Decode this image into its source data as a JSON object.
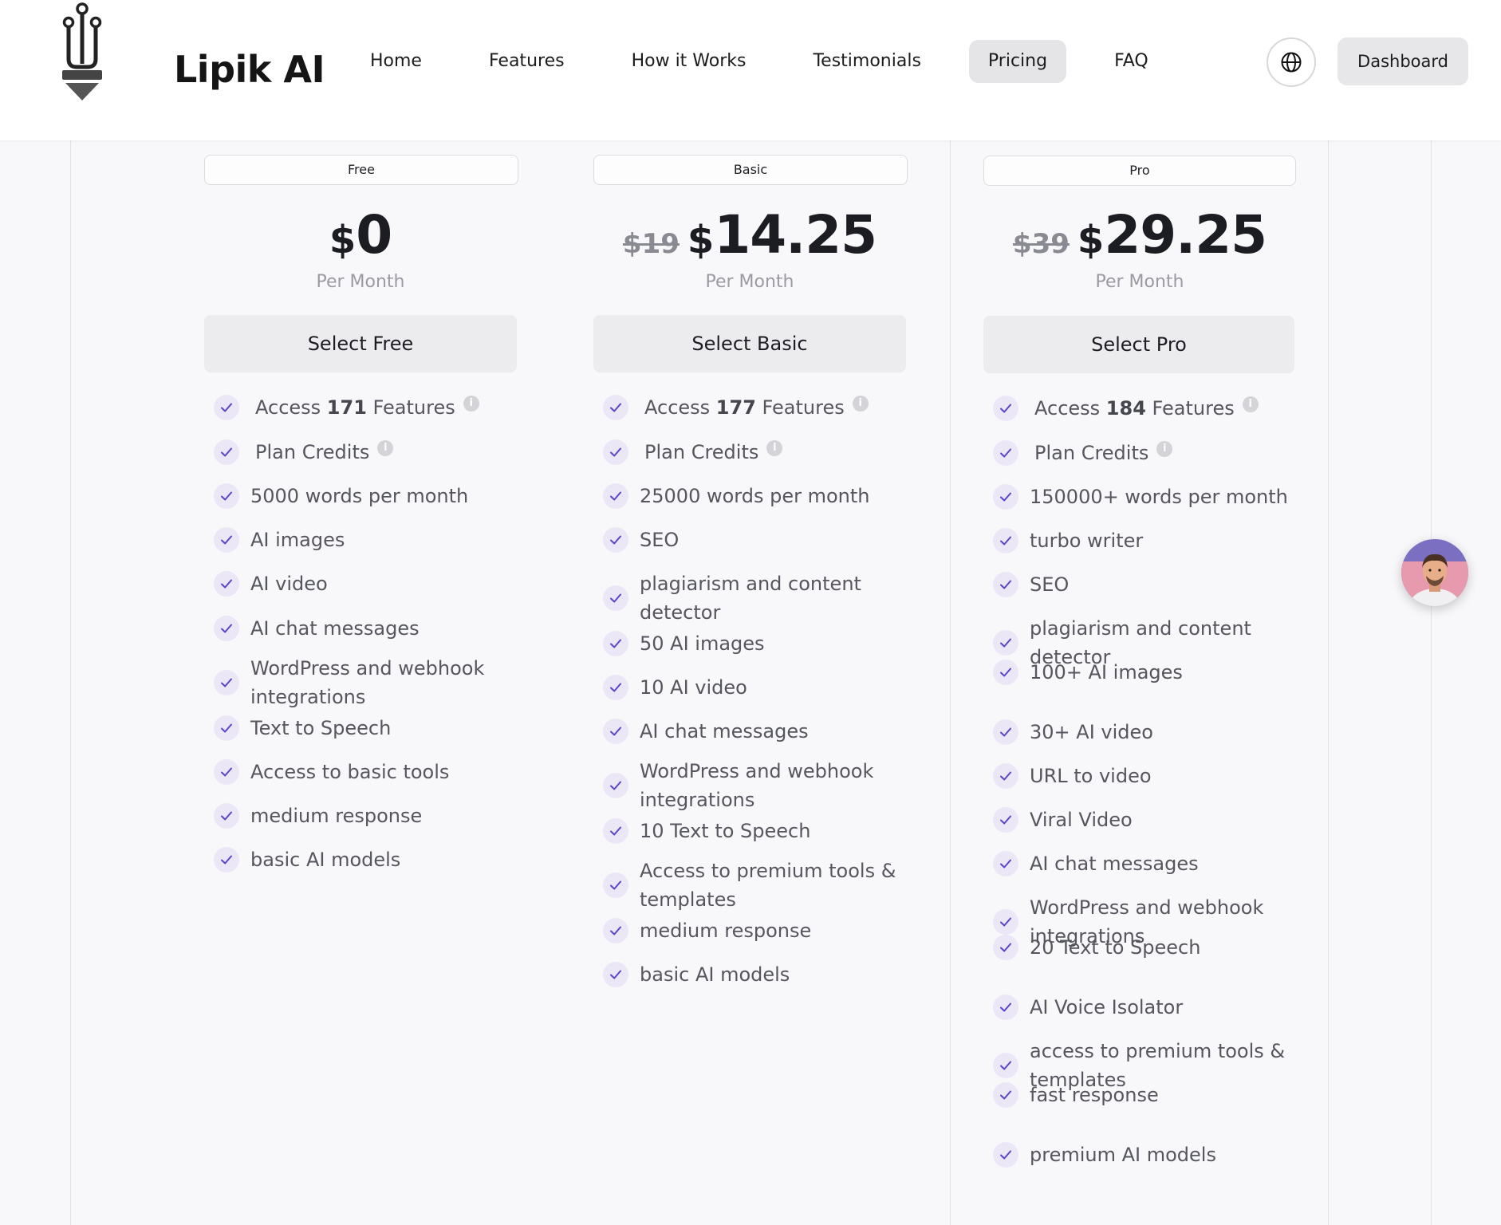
{
  "brand": {
    "name": "Lipik AI",
    "logo_icon": "pen-nib-logo-icon"
  },
  "nav": {
    "items": [
      {
        "label": "Home",
        "active": false
      },
      {
        "label": "Features",
        "active": false
      },
      {
        "label": "How it Works",
        "active": false
      },
      {
        "label": "Testimonials",
        "active": false
      },
      {
        "label": "Pricing",
        "active": true
      },
      {
        "label": "FAQ",
        "active": false
      }
    ],
    "language_icon": "globe-icon",
    "dashboard_label": "Dashboard"
  },
  "plans": [
    {
      "name": "Free",
      "old_price": "",
      "currency": "$",
      "price": "0",
      "period": "Per Month",
      "cta": "Select Free",
      "features": [
        {
          "pre": "Access ",
          "bold": "171",
          "post": " Features",
          "info": true
        },
        {
          "pre": "Plan Credits",
          "bold": "",
          "post": "",
          "info": true
        },
        {
          "text": "5000 words per month"
        },
        {
          "text": "AI images"
        },
        {
          "text": "AI video"
        },
        {
          "text": "AI chat messages"
        },
        {
          "text": "WordPress and webhook",
          "text2": "integrations"
        },
        {
          "text": "Text to Speech"
        },
        {
          "text": "Access to basic tools"
        },
        {
          "text": "medium response"
        },
        {
          "text": "basic AI models"
        }
      ]
    },
    {
      "name": "Basic",
      "old_price": "$19",
      "currency": "$",
      "price": "14.25",
      "period": "Per Month",
      "cta": "Select Basic",
      "features": [
        {
          "pre": "Access ",
          "bold": "177",
          "post": " Features",
          "info": true
        },
        {
          "pre": "Plan Credits",
          "bold": "",
          "post": "",
          "info": true
        },
        {
          "text": "25000 words per month"
        },
        {
          "text": "SEO"
        },
        {
          "text": "plagiarism and content",
          "text2": "detector"
        },
        {
          "text": "50 AI images"
        },
        {
          "text": "10 AI video"
        },
        {
          "text": "AI chat messages"
        },
        {
          "text": "WordPress and webhook",
          "text2": "integrations"
        },
        {
          "text": "10 Text to Speech"
        },
        {
          "text": "Access to premium tools &",
          "text2": "templates"
        },
        {
          "text": "medium response"
        },
        {
          "text": "basic AI models"
        }
      ]
    },
    {
      "name": "Pro",
      "old_price": "$39",
      "currency": "$",
      "price": "29.25",
      "period": "Per Month",
      "cta": "Select Pro",
      "features": [
        {
          "pre": "Access ",
          "bold": "184",
          "post": " Features",
          "info": true
        },
        {
          "pre": "Plan Credits",
          "bold": "",
          "post": "",
          "info": true
        },
        {
          "text": "150000+ words per month"
        },
        {
          "text": "turbo writer"
        },
        {
          "text": "SEO"
        },
        {
          "text": "plagiarism and content",
          "text2": "detector"
        },
        {
          "text": "100+ AI images"
        },
        {
          "text": "30+ AI video"
        },
        {
          "text": "URL to video"
        },
        {
          "text": "Viral Video"
        },
        {
          "text": "AI chat messages"
        },
        {
          "text": "WordPress and webhook",
          "text2": "integrations"
        },
        {
          "text": "20 Text to Speech"
        },
        {
          "text": "AI Voice Isolator"
        },
        {
          "text": "access to premium tools &",
          "text2": "templates"
        },
        {
          "text": "fast response"
        },
        {
          "text": "premium AI models"
        }
      ]
    }
  ],
  "icons": {
    "check": "check-icon",
    "info": "info-icon",
    "chat": "support-avatar"
  },
  "colors": {
    "check_bg": "#ebe7f7",
    "check_stroke": "#5b45c8",
    "nav_active_bg": "#e5e5e8"
  }
}
